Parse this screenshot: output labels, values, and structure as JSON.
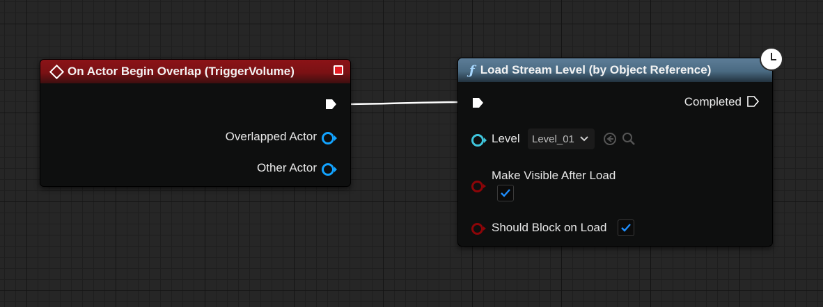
{
  "event_node": {
    "title": "On Actor Begin Overlap (TriggerVolume)",
    "pins": [
      "Overlapped Actor",
      "Other Actor"
    ],
    "header_color": "#7a1114",
    "pin_color": "#12a3ff"
  },
  "func_node": {
    "title": "Load Stream Level (by Object Reference)",
    "icon": "function-icon",
    "header_color": "#4a6a82",
    "completed_label": "Completed",
    "level_label": "Level",
    "level_value": "Level_01",
    "make_visible_label": "Make Visible After Load",
    "make_visible_checked": true,
    "block_on_load_label": "Should Block on Load",
    "block_on_load_checked": true,
    "latent_icon": "clock-icon"
  },
  "colors": {
    "background": "#262626",
    "exec_wire": "#ffffff",
    "bool_pin": "#8c0508",
    "object_pin": "#12a3ff",
    "level_pin": "#3fc5dc"
  }
}
